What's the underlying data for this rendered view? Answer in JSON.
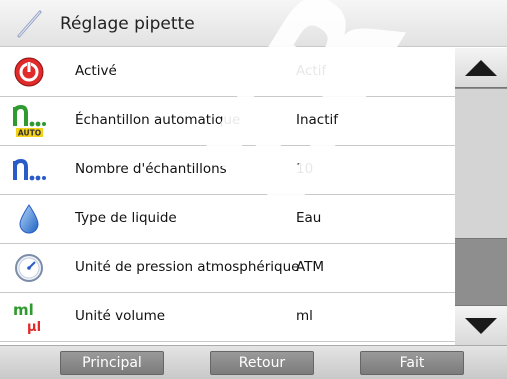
{
  "header": {
    "title": "Réglage pipette",
    "icon": "pipette-icon"
  },
  "rows": [
    {
      "label": "Activé",
      "value": "Actif",
      "icon": "power-icon"
    },
    {
      "label": "Échantillon automatique",
      "value": "Inactif",
      "icon": "auto-sample-icon",
      "icon_text": "AUTO"
    },
    {
      "label": "Nombre d'échantillons",
      "value": "10",
      "icon": "sample-count-icon"
    },
    {
      "label": "Type de liquide",
      "value": "Eau",
      "icon": "liquid-drop-icon"
    },
    {
      "label": "Unité de pression atmosphérique",
      "value": "ATM",
      "icon": "pressure-gauge-icon"
    },
    {
      "label": "Unité volume",
      "value": "ml",
      "icon": "volume-unit-icon",
      "icon_text": [
        "ml",
        "µl"
      ]
    }
  ],
  "footer": {
    "main_label": "Principal",
    "back_label": "Retour",
    "done_label": "Fait"
  },
  "scroll": {
    "up_icon": "arrow-up-icon",
    "down_icon": "arrow-down-icon"
  },
  "watermark": "ER S",
  "colors": {
    "power": "#e12a2a",
    "auto_green": "#2f9a2f",
    "blue": "#2a5cc8",
    "button": "#8a8a8a"
  }
}
